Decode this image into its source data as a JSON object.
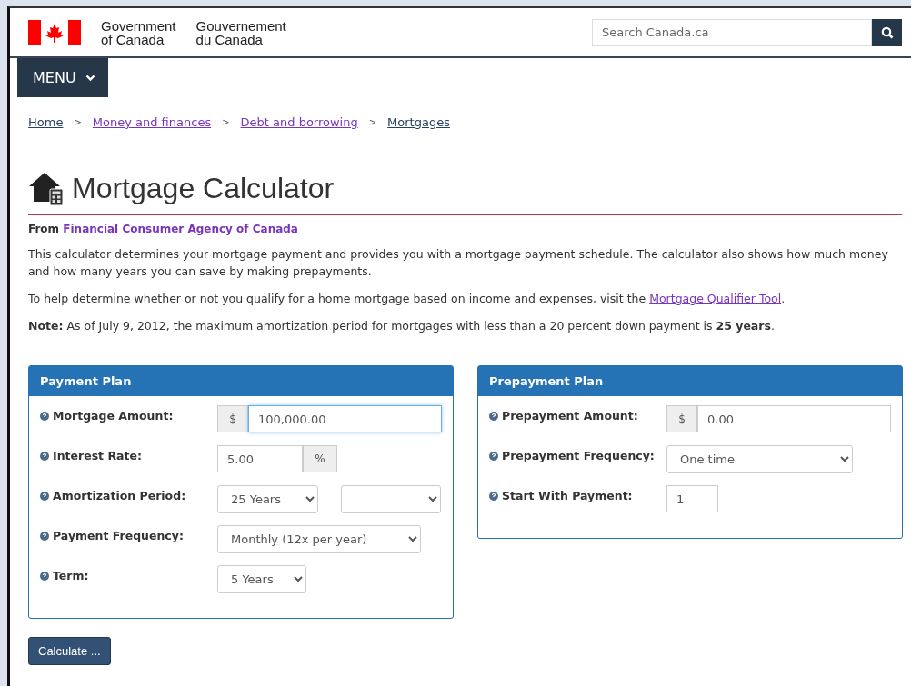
{
  "header": {
    "gov_en": [
      "Government",
      "of Canada"
    ],
    "gov_fr": [
      "Gouvernement",
      "du Canada"
    ],
    "search": {
      "placeholder": "Search Canada.ca"
    }
  },
  "menu": {
    "label": "MENU"
  },
  "breadcrumbs": [
    {
      "label": "Home",
      "visited": false
    },
    {
      "label": "Money and finances",
      "visited": true
    },
    {
      "label": "Debt and borrowing",
      "visited": true
    },
    {
      "label": "Mortgages",
      "visited": false
    }
  ],
  "breadcrumb_separator": ">",
  "title": "Mortgage Calculator",
  "source": {
    "prefix": "From",
    "link": "Financial Consumer Agency of Canada"
  },
  "paragraphs": [
    {
      "text": "This calculator determines your mortgage payment and provides you with a mortgage payment schedule. The calculator also shows how much money and how many years you can save by making prepayments."
    },
    {
      "text": "To help determine whether or not you qualify for a home mortgage based on income and expenses, visit the",
      "link": "Mortgage Qualifier Tool",
      "after": "."
    },
    {
      "text": "**Note:** As of July 9, 2012, the maximum amortization period for mortgages with less than a 20 percent down payment is **25 years**."
    }
  ],
  "panels": [
    {
      "title": "Payment Plan",
      "fields": [
        {
          "label": "Mortgage Amount:",
          "kind": "input",
          "prefix": "$",
          "value": "100,000.00",
          "focused": true
        },
        {
          "label": "Interest Rate:",
          "kind": "input",
          "suffix": "%",
          "value": "5.00",
          "focused": false
        },
        {
          "label": "Amortization Period:",
          "kind": "select_pair",
          "value": "25 Years"
        },
        {
          "label": "Payment Frequency:",
          "kind": "select",
          "value": "Monthly (12x per year)"
        },
        {
          "label": "Term:",
          "kind": "select",
          "value": "5 Years"
        }
      ]
    },
    {
      "title": "Prepayment Plan",
      "fields": [
        {
          "label": "Prepayment Amount:",
          "kind": "input",
          "prefix": "$",
          "value": "0.00",
          "focused": false
        },
        {
          "label": "Prepayment Frequency:",
          "kind": "select",
          "value": "One time"
        },
        {
          "label": "Start With Payment:",
          "kind": "input",
          "value": "1",
          "focused": false
        }
      ]
    }
  ],
  "calculate_button": "Calculate ..."
}
